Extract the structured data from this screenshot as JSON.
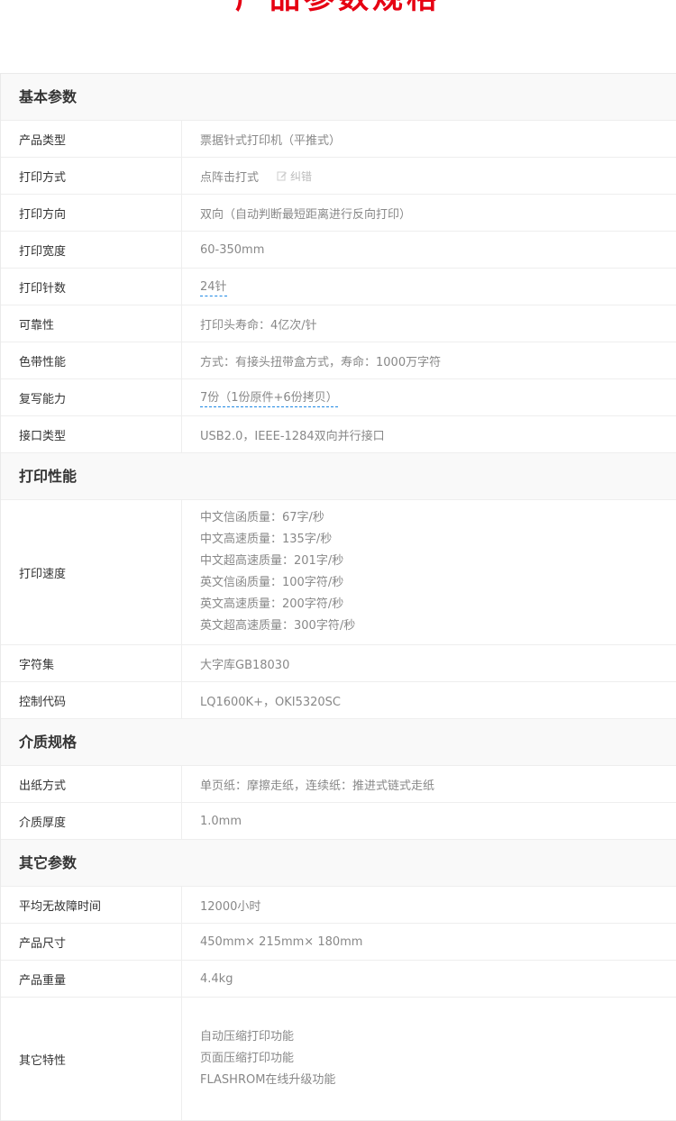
{
  "page_title": "产品参数规格",
  "correction_label": "纠错",
  "sections": [
    {
      "title": "基本参数",
      "rows": [
        {
          "name": "产品类型",
          "value": "票据针式打印机（平推式）"
        },
        {
          "name": "打印方式",
          "value": "点阵击打式"
        },
        {
          "name": "打印方向",
          "value": "双向（自动判断最短距离进行反向打印）"
        },
        {
          "name": "打印宽度",
          "value": "60-350mm"
        },
        {
          "name": "打印针数",
          "value": "24针"
        },
        {
          "name": "可靠性",
          "value": "打印头寿命：4亿次/针"
        },
        {
          "name": "色带性能",
          "value": "方式：有接头扭带盒方式，寿命：1000万字符"
        },
        {
          "name": "复写能力",
          "value": "7份（1份原件+6份拷贝）"
        },
        {
          "name": "接口类型",
          "value": "USB2.0，IEEE-1284双向并行接口"
        }
      ]
    },
    {
      "title": "打印性能",
      "rows": [
        {
          "name": "打印速度",
          "lines": [
            "中文信函质量：67字/秒",
            "中文高速质量：135字/秒",
            "中文超高速质量：201字/秒",
            "英文信函质量：100字符/秒",
            "英文高速质量：200字符/秒",
            "英文超高速质量：300字符/秒"
          ]
        },
        {
          "name": "字符集",
          "value": "大字库GB18030"
        },
        {
          "name": "控制代码",
          "value": "LQ1600K+，OKI5320SC"
        }
      ]
    },
    {
      "title": "介质规格",
      "rows": [
        {
          "name": "出纸方式",
          "value": "单页纸：摩擦走纸，连续纸：推进式链式走纸"
        },
        {
          "name": "介质厚度",
          "value": "1.0mm"
        }
      ]
    },
    {
      "title": "其它参数",
      "rows": [
        {
          "name": "平均无故障时间",
          "value": "12000小时"
        },
        {
          "name": "产品尺寸",
          "value": "450mm× 215mm× 180mm"
        },
        {
          "name": "产品重量",
          "value": "4.4kg"
        },
        {
          "name": "其它特性",
          "lines": [
            "自动压缩打印功能",
            "页面压缩打印功能",
            "FLASHROM在线升级功能"
          ]
        }
      ]
    }
  ]
}
